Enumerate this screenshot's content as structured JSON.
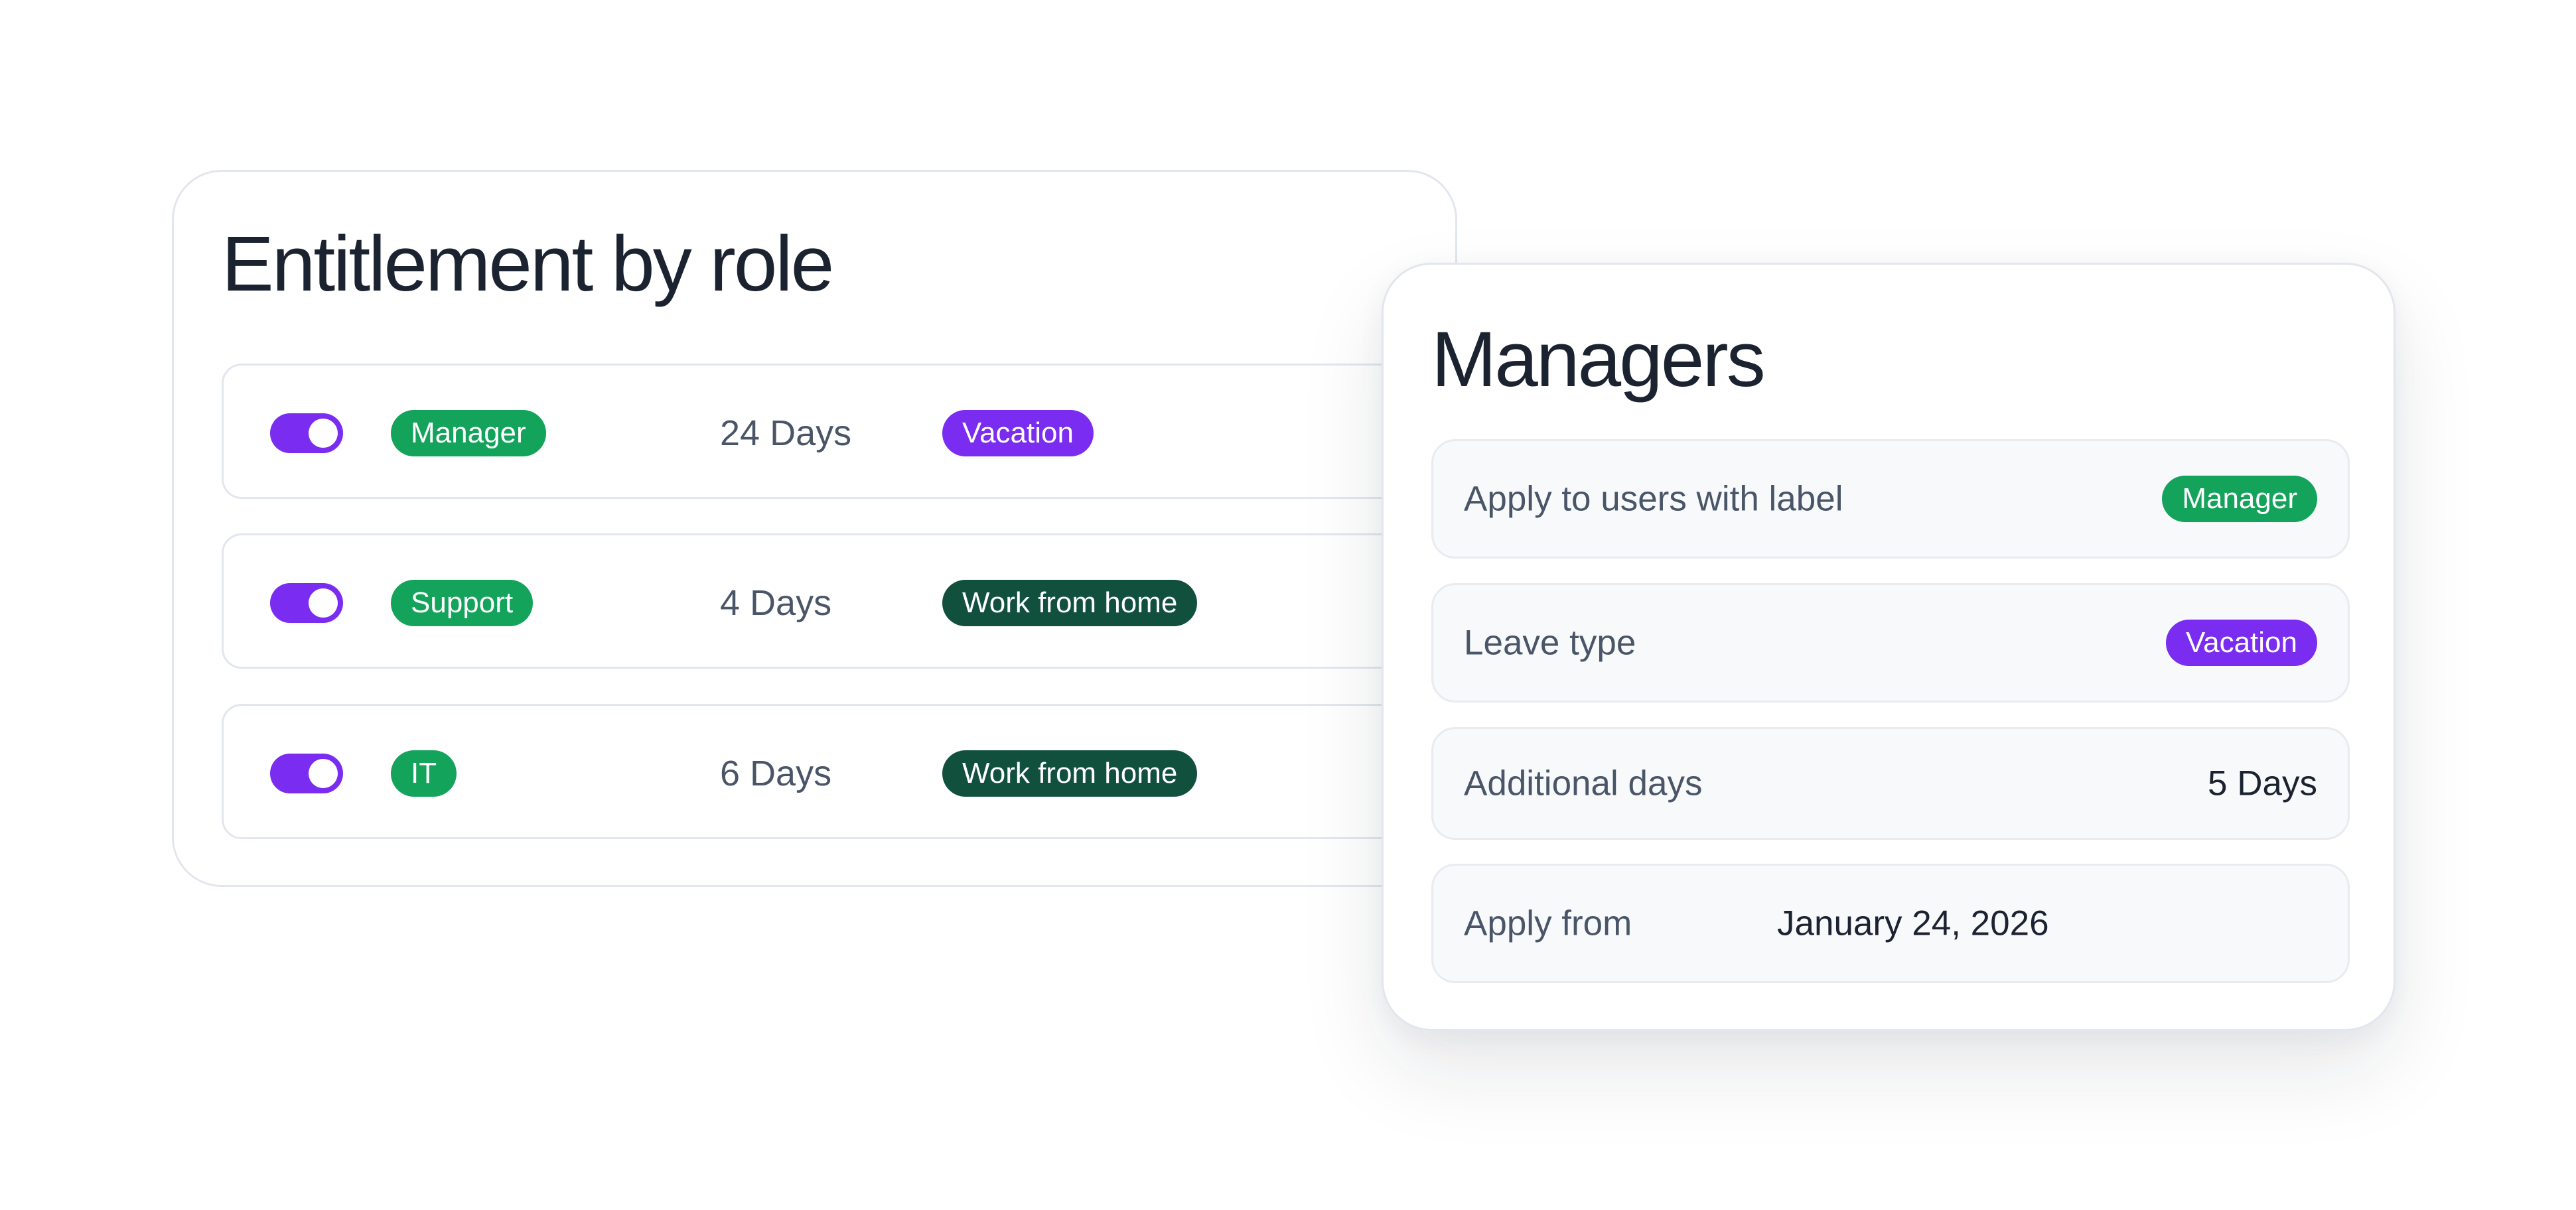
{
  "colors": {
    "accent_purple": "#7a2cf0",
    "label_green": "#13a35b",
    "label_dark_green": "#11503c",
    "text_dark": "#1c2330",
    "text_muted": "#4a5668"
  },
  "entitlement_card": {
    "title": "Entitlement by role",
    "rows": [
      {
        "enabled": true,
        "role": "Manager",
        "days": "24 Days",
        "leave_type": "Vacation",
        "leave_color": "purple"
      },
      {
        "enabled": true,
        "role": "Support",
        "days": "4 Days",
        "leave_type": "Work from home",
        "leave_color": "dark-green"
      },
      {
        "enabled": true,
        "role": "IT",
        "days": "6 Days",
        "leave_type": "Work from home",
        "leave_color": "dark-green"
      }
    ]
  },
  "managers_card": {
    "title": "Managers",
    "fields": {
      "apply_label": {
        "label": "Apply to users with label",
        "value": "Manager"
      },
      "leave_type": {
        "label": "Leave type",
        "value": "Vacation"
      },
      "additional_days": {
        "label": "Additional days",
        "value": "5 Days"
      },
      "apply_from": {
        "label": "Apply from",
        "value": "January 24, 2026"
      }
    }
  }
}
